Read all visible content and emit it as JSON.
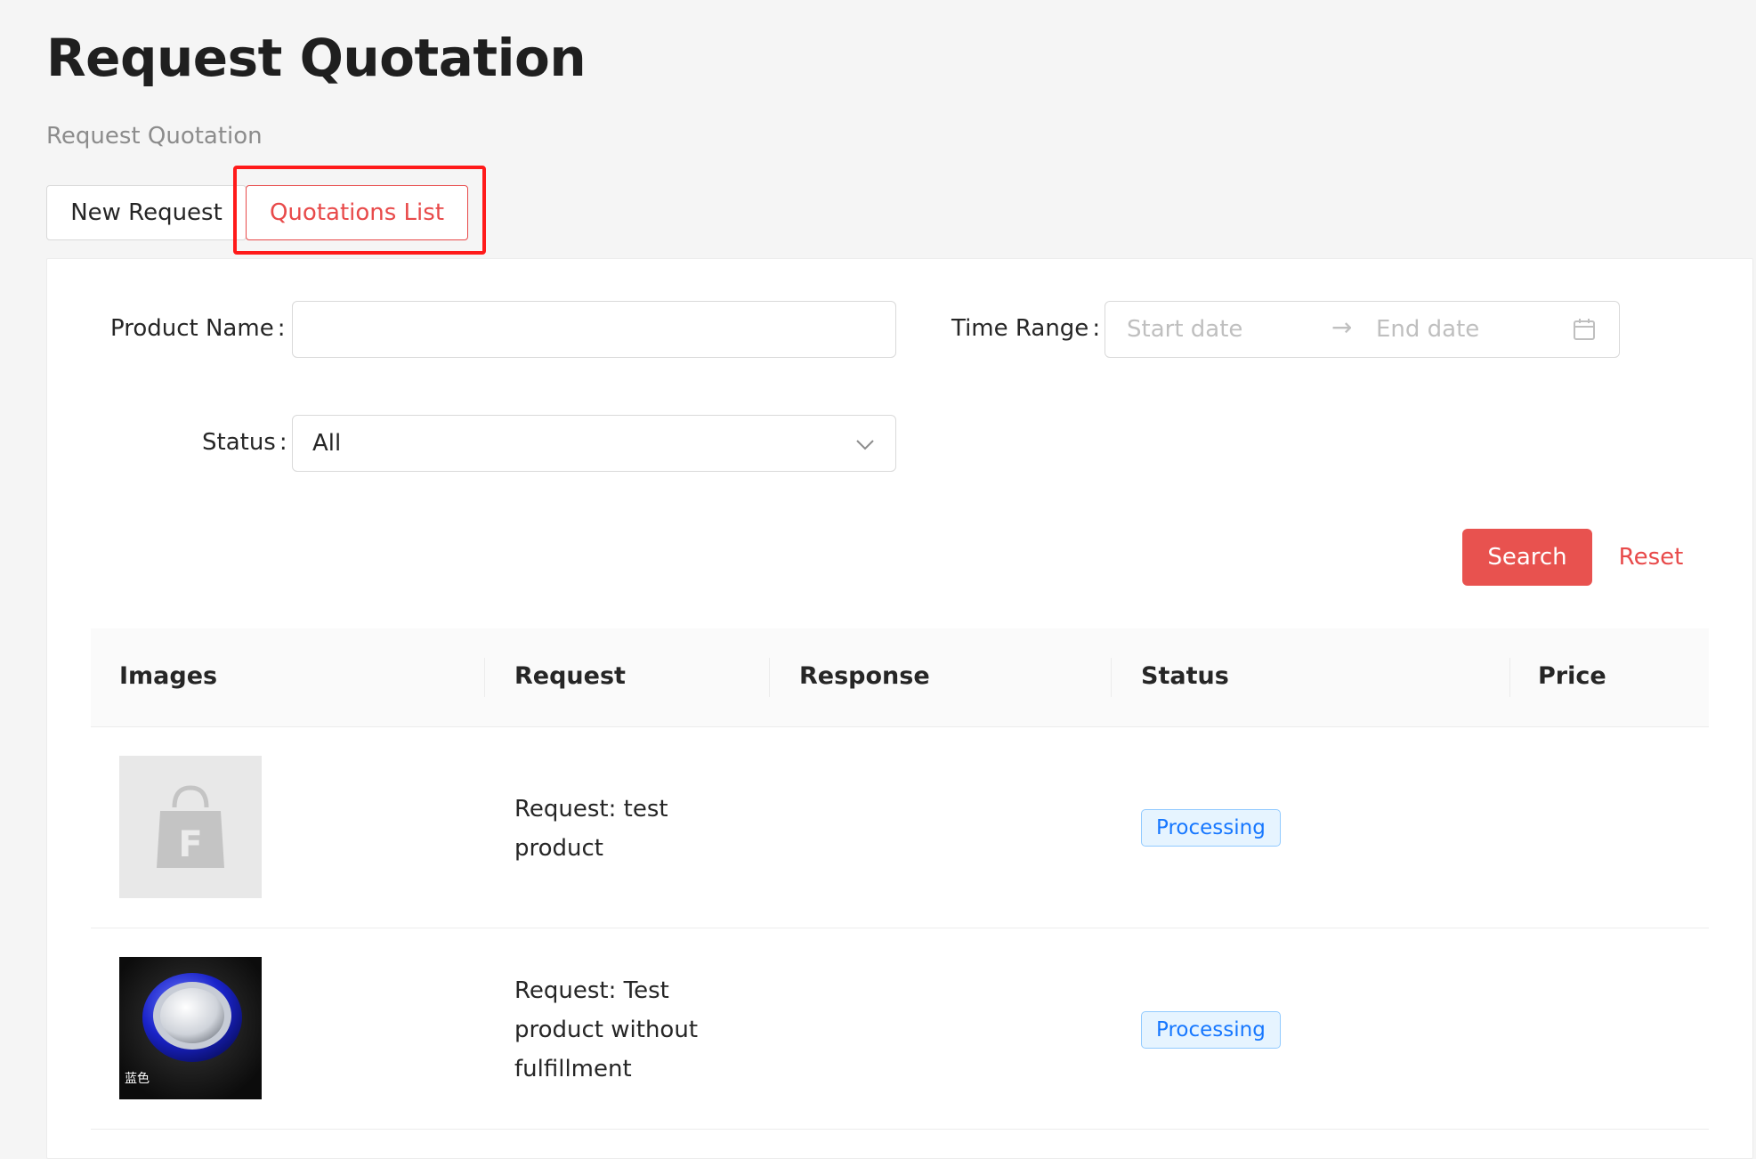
{
  "page": {
    "title": "Request Quotation",
    "breadcrumb": "Request Quotation"
  },
  "tabs": {
    "new_request": "New Request",
    "quotations_list": "Quotations List",
    "active": "quotations_list"
  },
  "filters": {
    "product_name": {
      "label": "Product Name",
      "colon": ":",
      "value": "",
      "placeholder": ""
    },
    "time_range": {
      "label": "Time Range",
      "colon": ":",
      "start_placeholder": "Start date",
      "separator": "→",
      "end_placeholder": "End date",
      "icon": "calendar-icon"
    },
    "status": {
      "label": "Status",
      "colon": ":",
      "value": "All",
      "icon": "chevron-down-icon"
    },
    "search_label": "Search",
    "reset_label": "Reset"
  },
  "table": {
    "columns": [
      "Images",
      "Request",
      "Response",
      "Status",
      "Price"
    ],
    "rows": [
      {
        "image": "placeholder-bag-icon",
        "request_line1": "Request: test",
        "request_line2": "product",
        "request_line3": "",
        "response": "",
        "status": "Processing",
        "price": ""
      },
      {
        "image": "ring-holder-product",
        "image_caption": "蓝色",
        "request_line1": "Request: Test",
        "request_line2": "product without",
        "request_line3": "fulfillment",
        "response": "",
        "status": "Processing",
        "price": ""
      }
    ]
  },
  "colors": {
    "accent": "#e84a4a",
    "search_button": "#e8524f",
    "highlight": "#ff1a1a",
    "tag_bg": "#e6f4ff",
    "tag_text": "#1677ff"
  }
}
